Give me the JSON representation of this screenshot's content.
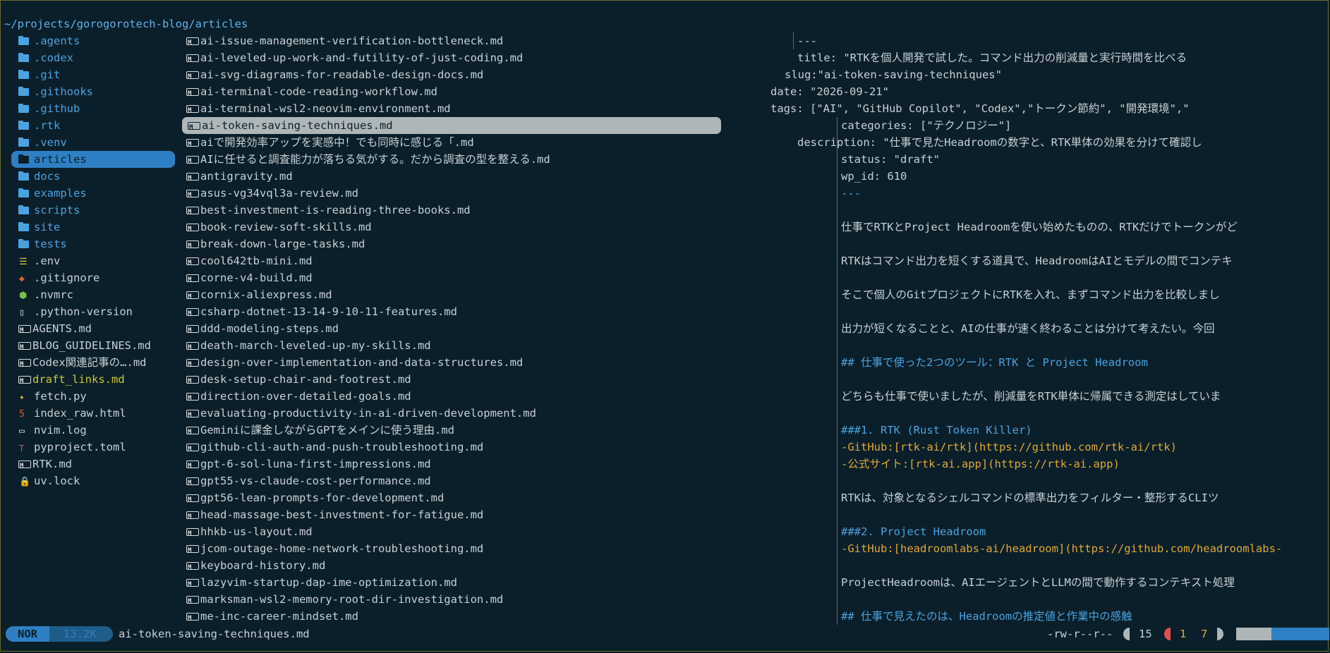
{
  "path": "~/projects/gorogorotech-blog/articles",
  "sidebar": {
    "selected_index": 8,
    "items": [
      {
        "label": ".agents",
        "icon": "folder-icon",
        "kind": "folder"
      },
      {
        "label": ".codex",
        "icon": "folder-icon",
        "kind": "folder"
      },
      {
        "label": ".git",
        "icon": "git-folder-icon",
        "kind": "folder"
      },
      {
        "label": ".githooks",
        "icon": "folder-icon",
        "kind": "folder"
      },
      {
        "label": ".github",
        "icon": "github-folder-icon",
        "kind": "folder"
      },
      {
        "label": ".rtk",
        "icon": "folder-icon",
        "kind": "folder"
      },
      {
        "label": ".venv",
        "icon": "folder-icon",
        "kind": "folder"
      },
      {
        "label": "articles",
        "icon": "open-folder-icon",
        "kind": "folder"
      },
      {
        "label": "docs",
        "icon": "folder-icon",
        "kind": "folder"
      },
      {
        "label": "examples",
        "icon": "folder-icon",
        "kind": "folder"
      },
      {
        "label": "scripts",
        "icon": "folder-icon",
        "kind": "folder"
      },
      {
        "label": "site",
        "icon": "folder-icon",
        "kind": "folder"
      },
      {
        "label": "tests",
        "icon": "folder-icon",
        "kind": "folder"
      },
      {
        "label": ".env",
        "icon": "env-icon",
        "kind": "env"
      },
      {
        "label": ".gitignore",
        "icon": "git-icon",
        "kind": "git"
      },
      {
        "label": ".nvmrc",
        "icon": "nodejs-icon",
        "kind": "node"
      },
      {
        "label": ".python-version",
        "icon": "file-icon",
        "kind": "file"
      },
      {
        "label": "AGENTS.md",
        "icon": "markdown-icon",
        "kind": "md"
      },
      {
        "label": "BLOG_GUIDELINES.md",
        "icon": "markdown-icon",
        "kind": "md"
      },
      {
        "label": "Codex関連記事の….md",
        "icon": "markdown-icon",
        "kind": "md"
      },
      {
        "label": "draft_links.md",
        "icon": "markdown-icon",
        "kind": "md-yellow"
      },
      {
        "label": "fetch.py",
        "icon": "python-icon",
        "kind": "py"
      },
      {
        "label": "index_raw.html",
        "icon": "html5-icon",
        "kind": "html"
      },
      {
        "label": "nvim.log",
        "icon": "log-icon",
        "kind": "log"
      },
      {
        "label": "pyproject.toml",
        "icon": "toml-icon",
        "kind": "toml"
      },
      {
        "label": "RTK.md",
        "icon": "markdown-icon",
        "kind": "md"
      },
      {
        "label": "uv.lock",
        "icon": "lock-icon",
        "kind": "lock"
      }
    ]
  },
  "files": {
    "selected_index": 5,
    "items": [
      "ai-issue-management-verification-bottleneck.md",
      "ai-leveled-up-work-and-futility-of-just-coding.md",
      "ai-svg-diagrams-for-readable-design-docs.md",
      "ai-terminal-code-reading-workflow.md",
      "ai-terminal-wsl2-neovim-environment.md",
      "ai-token-saving-techniques.md",
      "aiで開発効率アップを実感中！でも同時に感じる「.md",
      "AIに任せると調査能力が落ちる気がする。だから調査の型を整える.md",
      "antigravity.md",
      "asus-vg34vql3a-review.md",
      "best-investment-is-reading-three-books.md",
      "book-review-soft-skills.md",
      "break-down-large-tasks.md",
      "cool642tb-mini.md",
      "corne-v4-build.md",
      "cornix-aliexpress.md",
      "csharp-dotnet-13-14-9-10-11-features.md",
      "ddd-modeling-steps.md",
      "death-march-leveled-up-my-skills.md",
      "design-over-implementation-and-data-structures.md",
      "desk-setup-chair-and-footrest.md",
      "direction-over-detailed-goals.md",
      "evaluating-productivity-in-ai-driven-development.md",
      "Geminiに課金しながらGPTをメインに使う理由.md",
      "github-cli-auth-and-push-troubleshooting.md",
      "gpt-6-sol-luna-first-impressions.md",
      "gpt55-vs-claude-cost-performance.md",
      "gpt56-lean-prompts-for-development.md",
      "head-massage-best-investment-for-fatigue.md",
      "hhkb-us-layout.md",
      "jcom-outage-home-network-troubleshooting.md",
      "keyboard-history.md",
      "lazyvim-startup-dap-ime-optimization.md",
      "marksman-wsl2-memory-root-dir-investigation.md",
      "me-inc-career-mindset.md"
    ]
  },
  "preview": {
    "lines": [
      {
        "text": "---",
        "indent": 38,
        "style": "key"
      },
      {
        "text": "title: \"RTKを個人開発で試した。コマンド出力の削減量と実行時間を比べる",
        "indent": 38,
        "style": "key"
      },
      {
        "text": "slug:\"ai-token-saving-techniques\"",
        "indent": 20,
        "style": "key"
      },
      {
        "text": "date: \"2026-09-21\"",
        "indent": 0,
        "style": "key"
      },
      {
        "text": "tags: [\"AI\", \"GitHub Copilot\", \"Codex\",\"トークン節約\", \"開発環境\",\"",
        "indent": 0,
        "style": "key"
      },
      {
        "text": "categories: [\"テクノロジー\"]",
        "indent": 100,
        "style": "key"
      },
      {
        "text": "description: \"仕事で見たHeadroomの数字と、RTK単体の効果を分けて確認し",
        "indent": 38,
        "style": "key"
      },
      {
        "text": "status: \"draft\"",
        "indent": 100,
        "style": "key"
      },
      {
        "text": "wp_id: 610",
        "indent": 100,
        "style": "key"
      },
      {
        "text": "---",
        "indent": 100,
        "style": "dashes"
      },
      {
        "text": "",
        "indent": 100,
        "style": "key"
      },
      {
        "text": "仕事でRTKとProject Headroomを使い始めたものの、RTKだけでトークンがど",
        "indent": 100,
        "style": "key"
      },
      {
        "text": "",
        "indent": 100,
        "style": "key"
      },
      {
        "text": "RTKはコマンド出力を短くする道具で、HeadroomはAIとモデルの間でコンテキ",
        "indent": 100,
        "style": "key"
      },
      {
        "text": "",
        "indent": 100,
        "style": "key"
      },
      {
        "text": "そこで個人のGitプロジェクトにRTKを入れ、まずコマンド出力を比較しまし",
        "indent": 100,
        "style": "key"
      },
      {
        "text": "",
        "indent": 100,
        "style": "key"
      },
      {
        "text": "出力が短くなることと、AIの仕事が速く終わることは分けて考えたい。今回",
        "indent": 100,
        "style": "key"
      },
      {
        "text": "",
        "indent": 100,
        "style": "key"
      },
      {
        "text": "## 仕事で使った2つのツール：RTK と Project Headroom",
        "indent": 100,
        "style": "heading"
      },
      {
        "text": "",
        "indent": 100,
        "style": "key"
      },
      {
        "text": "どちらも仕事で使いましたが、削減量をRTK単体に帰属できる測定はしていま",
        "indent": 100,
        "style": "key"
      },
      {
        "text": "",
        "indent": 100,
        "style": "key"
      },
      {
        "text": "###1. RTK (Rust Token Killer)",
        "indent": 100,
        "style": "heading"
      },
      {
        "text": "-GitHub:[rtk-ai/rtk](https://github.com/rtk-ai/rtk)",
        "indent": 100,
        "style": "link"
      },
      {
        "text": "-公式サイト:[rtk-ai.app](https://rtk-ai.app)",
        "indent": 100,
        "style": "link"
      },
      {
        "text": "",
        "indent": 100,
        "style": "key"
      },
      {
        "text": "RTKは、対象となるシェルコマンドの標準出力をフィルター・整形するCLIツ",
        "indent": 100,
        "style": "key"
      },
      {
        "text": "",
        "indent": 100,
        "style": "key"
      },
      {
        "text": "###2. Project Headroom",
        "indent": 100,
        "style": "heading"
      },
      {
        "text": "-GitHub:[headroomlabs-ai/headroom](https://github.com/headroomlabs-",
        "indent": 100,
        "style": "link"
      },
      {
        "text": "",
        "indent": 100,
        "style": "key"
      },
      {
        "text": "ProjectHeadroomは、AIエージェントとLLMの間で動作するコンテキスト処理",
        "indent": 100,
        "style": "key"
      },
      {
        "text": "",
        "indent": 100,
        "style": "key"
      },
      {
        "text": "## 仕事で見えたのは、Headroomの推定値と作業中の感触",
        "indent": 100,
        "style": "heading"
      }
    ]
  },
  "status": {
    "mode": "NOR",
    "size": "13.2K",
    "filename": "ai-token-saving-techniques.md",
    "permissions": "-rw-r--r--",
    "position": "15",
    "errors": "1",
    "warnings": "7",
    "progress_fraction": 0.38
  },
  "colors": {
    "background": "#0b1f2a",
    "accent": "#2f7fc4",
    "folder": "#4aa3e0",
    "link": "#e0a83a",
    "selection": "#aeb6b8"
  }
}
